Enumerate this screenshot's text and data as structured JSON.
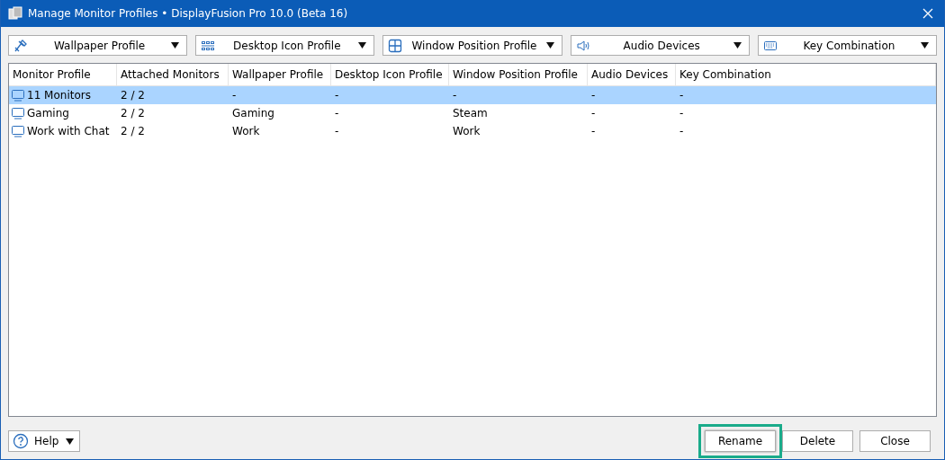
{
  "window": {
    "title": "Manage Monitor Profiles • DisplayFusion Pro 10.0 (Beta 16)"
  },
  "dropdowns": [
    {
      "kind": "wallpaper",
      "label": "Wallpaper Profile"
    },
    {
      "kind": "desktop",
      "label": "Desktop Icon Profile"
    },
    {
      "kind": "window",
      "label": "Window Position Profile"
    },
    {
      "kind": "audio",
      "label": "Audio Devices"
    },
    {
      "kind": "keyboard",
      "label": "Key Combination"
    }
  ],
  "table": {
    "columns": [
      "Monitor Profile",
      "Attached Monitors",
      "Wallpaper Profile",
      "Desktop Icon Profile",
      "Window Position Profile",
      "Audio Devices",
      "Key Combination"
    ],
    "rows": [
      {
        "selected": true,
        "cells": [
          "11 Monitors",
          "2 / 2",
          "-",
          "-",
          "-",
          "-",
          "-"
        ]
      },
      {
        "selected": false,
        "cells": [
          "Gaming",
          "2 / 2",
          "Gaming",
          "-",
          "Steam",
          "-",
          "-"
        ]
      },
      {
        "selected": false,
        "cells": [
          "Work with Chat",
          "2 / 2",
          "Work",
          "-",
          "Work",
          "-",
          "-"
        ]
      }
    ]
  },
  "help_button": {
    "label": "Help"
  },
  "buttons": [
    {
      "label": "Rename",
      "highlighted": true
    },
    {
      "label": "Delete",
      "highlighted": false
    },
    {
      "label": "Close",
      "highlighted": false
    }
  ]
}
